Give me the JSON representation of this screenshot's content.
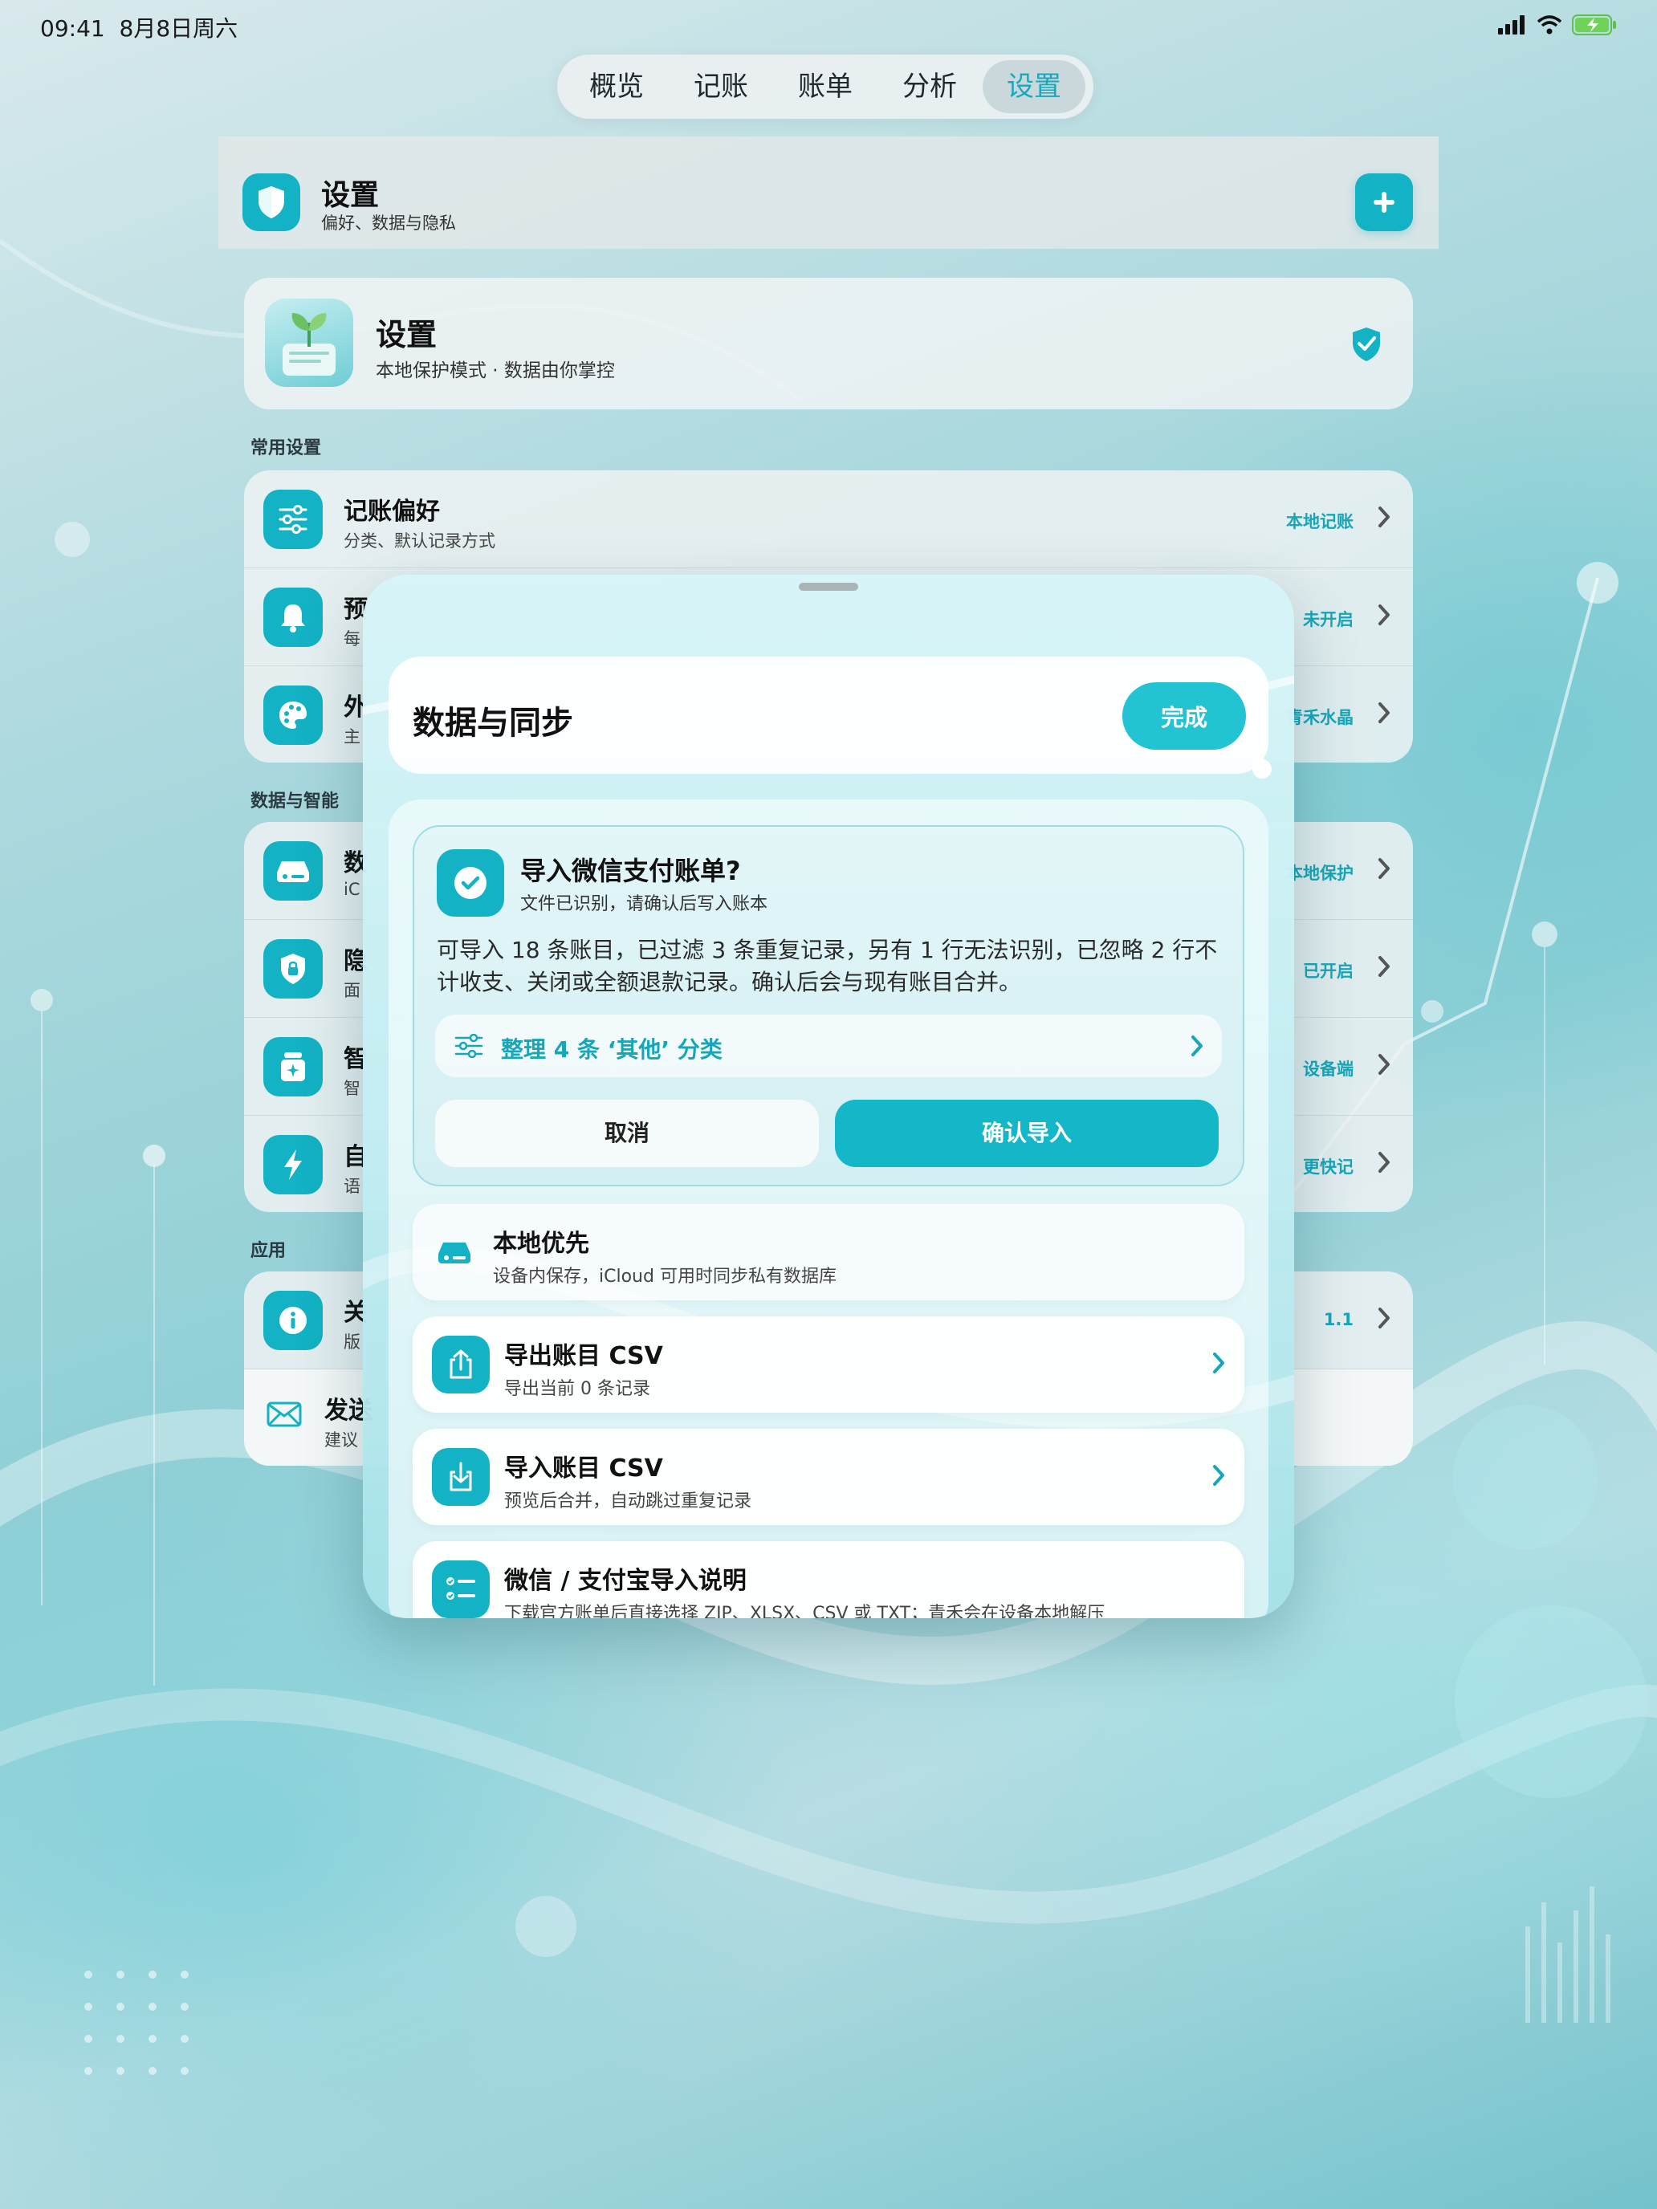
{
  "status_bar": {
    "time": "09:41",
    "date": "8月8日周六"
  },
  "tabs": [
    {
      "label": "概览",
      "active": false
    },
    {
      "label": "记账",
      "active": false
    },
    {
      "label": "账单",
      "active": false
    },
    {
      "label": "分析",
      "active": false
    },
    {
      "label": "设置",
      "active": true
    }
  ],
  "header": {
    "title": "设置",
    "subtitle": "偏好、数据与隐私",
    "icon": "shield-icon",
    "add_icon": "plus-icon"
  },
  "hero": {
    "title": "设置",
    "subtitle": "本地保护模式 · 数据由你掌控",
    "status_icon": "shield-check-icon"
  },
  "sections": {
    "common": {
      "label": "常用设置",
      "rows": [
        {
          "title": "记账偏好",
          "subtitle": "分类、默认记录方式",
          "value": "本地记账",
          "icon": "sliders-icon"
        },
        {
          "title": "预",
          "subtitle": "每",
          "value": "未开启",
          "icon": "bell-icon"
        },
        {
          "title": "外",
          "subtitle": "主",
          "value": "青禾水晶",
          "icon": "palette-icon"
        }
      ]
    },
    "data": {
      "label": "数据与智能",
      "rows": [
        {
          "title": "数",
          "subtitle": "iC",
          "value": "本地保护",
          "icon": "drive-icon"
        },
        {
          "title": "隐",
          "subtitle": "面",
          "value": "已开启",
          "icon": "lock-shield-icon"
        },
        {
          "title": "智",
          "subtitle": "智",
          "value": "设备端",
          "icon": "spark-box-icon"
        },
        {
          "title": "自",
          "subtitle": "语",
          "value": "更快记",
          "icon": "bolt-icon"
        }
      ]
    },
    "app": {
      "label": "应用",
      "rows": [
        {
          "title": "关",
          "subtitle": "版",
          "value": "1.1",
          "icon": "info-icon"
        },
        {
          "title": "发送",
          "subtitle": "建议",
          "value": "",
          "icon": "mail-icon"
        }
      ]
    }
  },
  "modal": {
    "title": "数据与同步",
    "done_label": "完成",
    "import_card": {
      "title": "导入微信支付账单?",
      "subtitle": "文件已识别，请确认后写入账本",
      "description": "可导入 18 条账目，已过滤 3 条重复记录，另有 1 行无法识别，已忽略 2 行不计收支、关闭或全额退款记录。确认后会与现有账目合并。",
      "organize_label": "整理 4 条 ‘其他’ 分类",
      "cancel_label": "取消",
      "confirm_label": "确认导入"
    },
    "options": [
      {
        "title": "本地优先",
        "subtitle": "设备内保存，iCloud 可用时同步私有数据库",
        "icon": "drive-icon",
        "chevron": false
      },
      {
        "title": "导出账目 CSV",
        "subtitle": "导出当前 0 条记录",
        "icon": "share-icon",
        "chevron": true
      },
      {
        "title": "导入账目 CSV",
        "subtitle": "预览后合并，自动跳过重复记录",
        "icon": "download-icon",
        "chevron": true
      },
      {
        "title": "微信 / 支付宝导入说明",
        "subtitle": "下载官方账单后直接选择 ZIP、XLSX、CSV 或 TXT；青禾会在设备本地解压",
        "icon": "checklist-icon",
        "chevron": false
      }
    ]
  },
  "colors": {
    "accent": "#13b2c4",
    "accent_text": "#17a6b8"
  }
}
